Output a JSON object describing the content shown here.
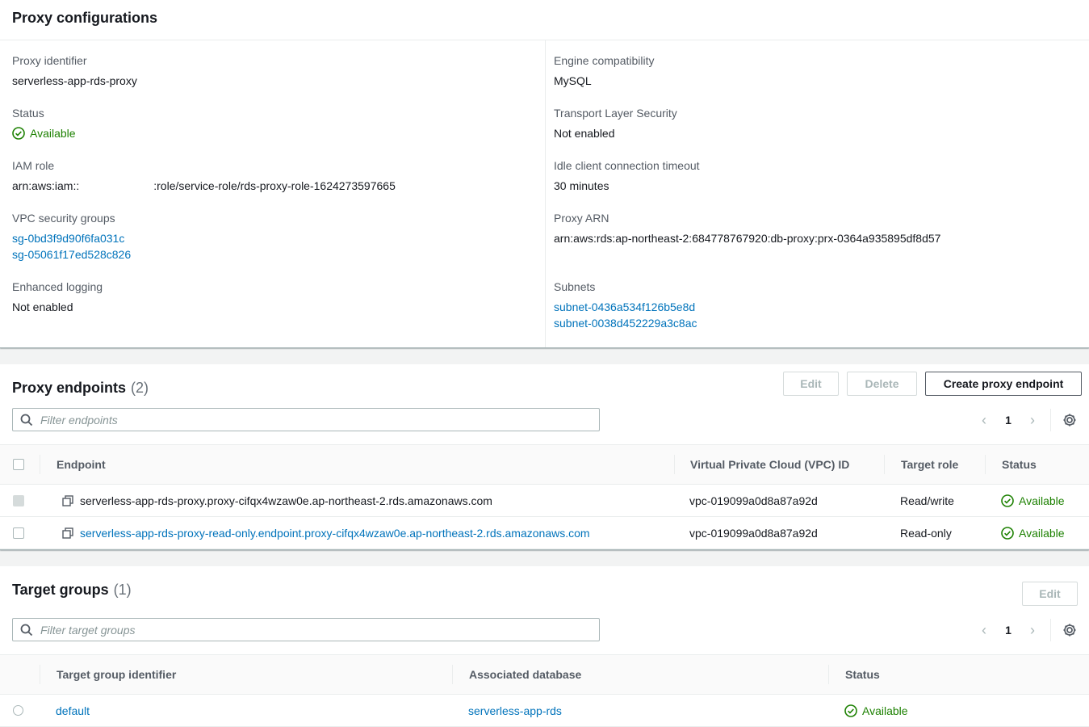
{
  "config": {
    "title": "Proxy configurations",
    "proxy_identifier": {
      "label": "Proxy identifier",
      "value": "serverless-app-rds-proxy"
    },
    "status": {
      "label": "Status",
      "value": "Available"
    },
    "iam_role": {
      "label": "IAM role",
      "value_prefix": "arn:aws:iam::",
      "value_suffix": ":role/service-role/rds-proxy-role-1624273597665"
    },
    "vpc_security_groups": {
      "label": "VPC security groups",
      "items": [
        "sg-0bd3f9d90f6fa031c",
        "sg-05061f17ed528c826"
      ]
    },
    "enhanced_logging": {
      "label": "Enhanced logging",
      "value": "Not enabled"
    },
    "engine_compatibility": {
      "label": "Engine compatibility",
      "value": "MySQL"
    },
    "tls": {
      "label": "Transport Layer Security",
      "value": "Not enabled"
    },
    "idle_timeout": {
      "label": "Idle client connection timeout",
      "value": "30 minutes"
    },
    "proxy_arn": {
      "label": "Proxy ARN",
      "value": "arn:aws:rds:ap-northeast-2:684778767920:db-proxy:prx-0364a935895df8d57"
    },
    "subnets": {
      "label": "Subnets",
      "items": [
        "subnet-0436a534f126b5e8d",
        "subnet-0038d452229a3c8ac"
      ]
    }
  },
  "endpoints": {
    "title": "Proxy endpoints",
    "count": "(2)",
    "buttons": {
      "edit": "Edit",
      "delete": "Delete",
      "create": "Create proxy endpoint"
    },
    "filter_placeholder": "Filter endpoints",
    "page": "1",
    "columns": {
      "endpoint": "Endpoint",
      "vpc": "Virtual Private Cloud (VPC) ID",
      "role": "Target role",
      "status": "Status"
    },
    "rows": [
      {
        "endpoint": "serverless-app-rds-proxy.proxy-cifqx4wzaw0e.ap-northeast-2.rds.amazonaws.com",
        "vpc": "vpc-019099a0d8a87a92d",
        "role": "Read/write",
        "status": "Available"
      },
      {
        "endpoint": "serverless-app-rds-proxy-read-only.endpoint.proxy-cifqx4wzaw0e.ap-northeast-2.rds.amazonaws.com",
        "vpc": "vpc-019099a0d8a87a92d",
        "role": "Read-only",
        "status": "Available"
      }
    ]
  },
  "targets": {
    "title": "Target groups",
    "count": "(1)",
    "buttons": {
      "edit": "Edit"
    },
    "filter_placeholder": "Filter target groups",
    "page": "1",
    "columns": {
      "identifier": "Target group identifier",
      "database": "Associated database",
      "status": "Status"
    },
    "rows": [
      {
        "identifier": "default",
        "database": "serverless-app-rds",
        "status": "Available"
      }
    ]
  },
  "colors": {
    "link": "#0073bb",
    "success": "#1d8102",
    "text": "#16191f",
    "label": "#545b64"
  }
}
